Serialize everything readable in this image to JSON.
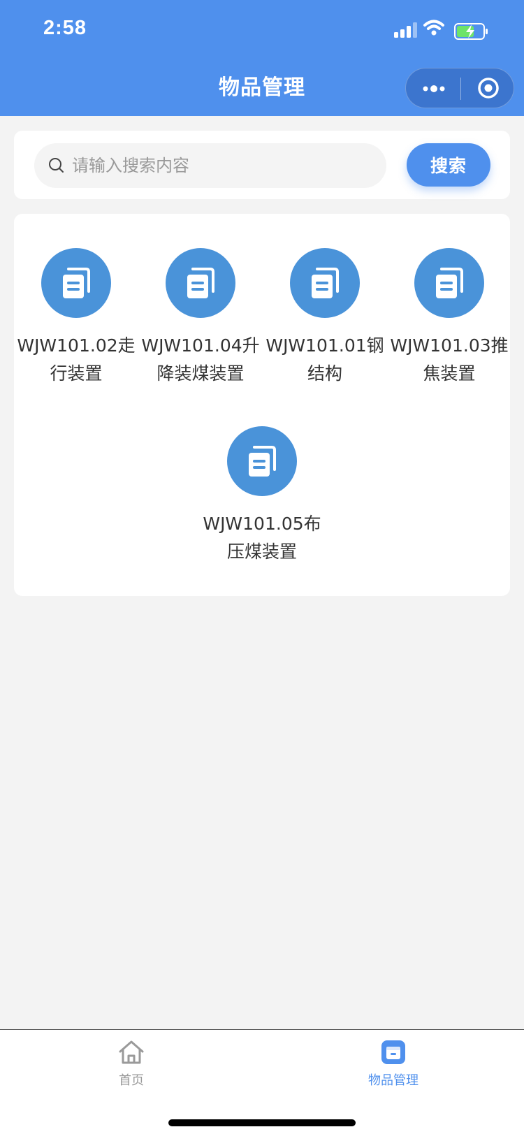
{
  "status_bar": {
    "time": "2:58"
  },
  "header": {
    "title": "物品管理"
  },
  "search": {
    "placeholder": "请输入搜索内容",
    "value": "",
    "button_label": "搜索"
  },
  "items": [
    {
      "label": "WJW101.02走行装置"
    },
    {
      "label": "WJW101.04升降装煤装置"
    },
    {
      "label": "WJW101.01钢结构"
    },
    {
      "label": "WJW101.03推焦装置"
    },
    {
      "label": "WJW101.05布压煤装置"
    }
  ],
  "tabbar": {
    "home_label": "首页",
    "goods_label": "物品管理"
  },
  "colors": {
    "primary": "#4f90ed",
    "icon_circle": "#4a93d9",
    "background": "#f3f3f3",
    "tab_inactive": "#999999"
  }
}
